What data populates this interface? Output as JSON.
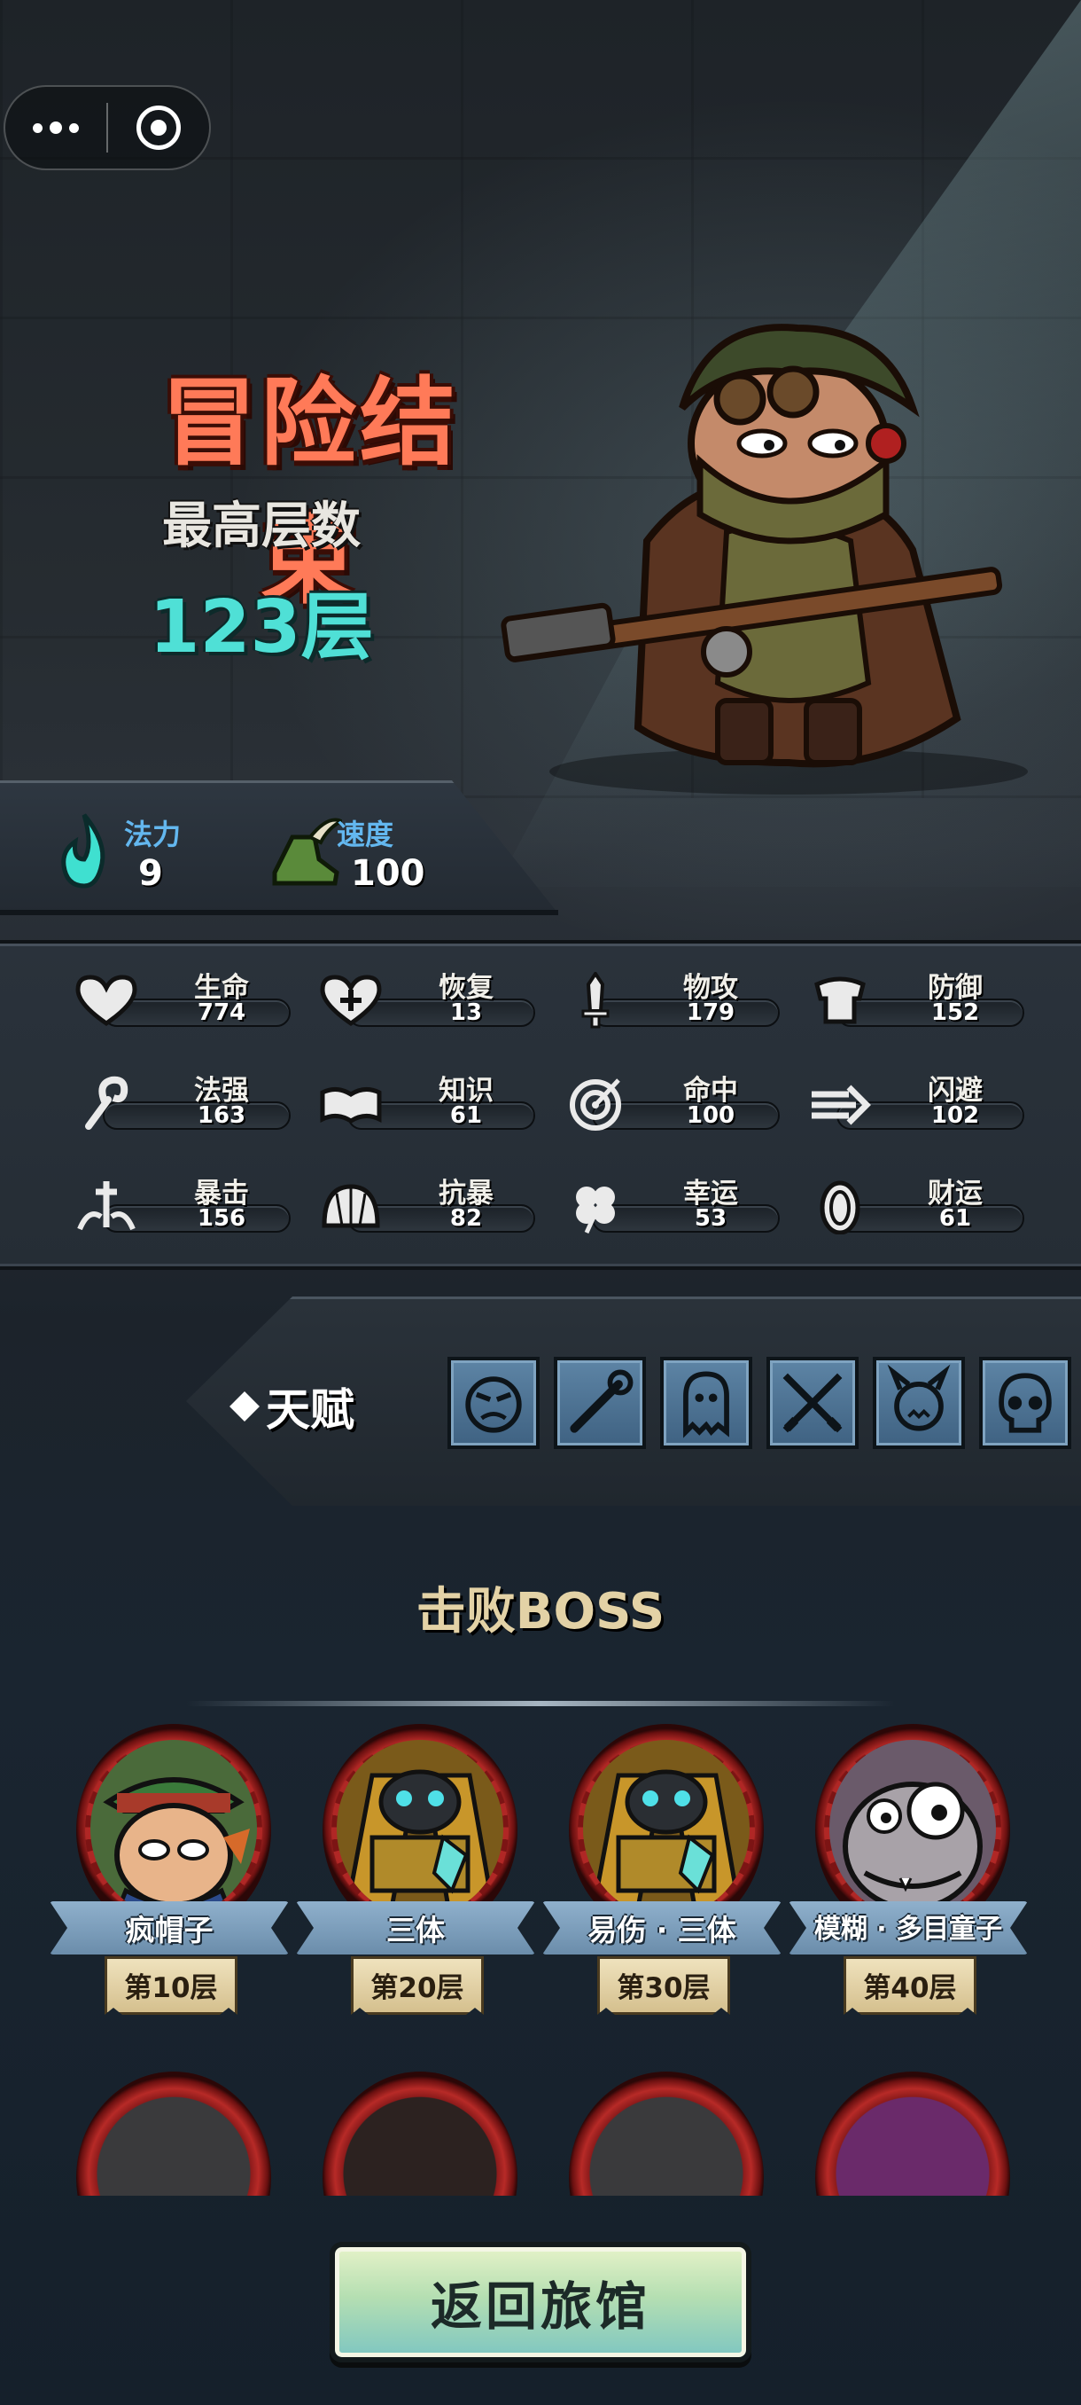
{
  "result": {
    "title": "冒险结束",
    "subtitle": "最高层数",
    "floor": "123层"
  },
  "top_stats": [
    {
      "label": "法力",
      "value": "9",
      "icon": "flame-icon"
    },
    {
      "label": "速度",
      "value": "100",
      "icon": "winged-boot-icon"
    }
  ],
  "stats": [
    {
      "label": "生命",
      "value": "774",
      "icon": "heart-icon"
    },
    {
      "label": "恢复",
      "value": "13",
      "icon": "heart-plus-icon"
    },
    {
      "label": "物攻",
      "value": "179",
      "icon": "sword-icon"
    },
    {
      "label": "防御",
      "value": "152",
      "icon": "armor-icon"
    },
    {
      "label": "法强",
      "value": "163",
      "icon": "staff-icon"
    },
    {
      "label": "知识",
      "value": "61",
      "icon": "book-icon"
    },
    {
      "label": "命中",
      "value": "100",
      "icon": "target-icon"
    },
    {
      "label": "闪避",
      "value": "102",
      "icon": "dash-icon"
    },
    {
      "label": "暴击",
      "value": "156",
      "icon": "crit-icon"
    },
    {
      "label": "抗暴",
      "value": "82",
      "icon": "shell-icon"
    },
    {
      "label": "幸运",
      "value": "53",
      "icon": "clover-icon"
    },
    {
      "label": "财运",
      "value": "61",
      "icon": "coin-icon"
    }
  ],
  "talent": {
    "label": "天赋",
    "icons": [
      "angry-face-icon",
      "staff-icon",
      "ghost-icon",
      "crossed-swords-icon",
      "demon-icon",
      "skull-icon"
    ]
  },
  "bosses": {
    "title": "击败BOSS",
    "items": [
      {
        "name": "疯帽子",
        "floor": "第10层"
      },
      {
        "name": "三体",
        "floor": "第20层"
      },
      {
        "name": "易伤 · 三体",
        "floor": "第30层"
      },
      {
        "name": "模糊 · 多目童子",
        "floor": "第40层"
      }
    ]
  },
  "back_button": "返回旅馆",
  "colors": {
    "title": "#ff7a58",
    "floor": "#4fe0d6",
    "stat_label_blue": "#63b7ef",
    "boss_title": "#e3d2a6"
  }
}
